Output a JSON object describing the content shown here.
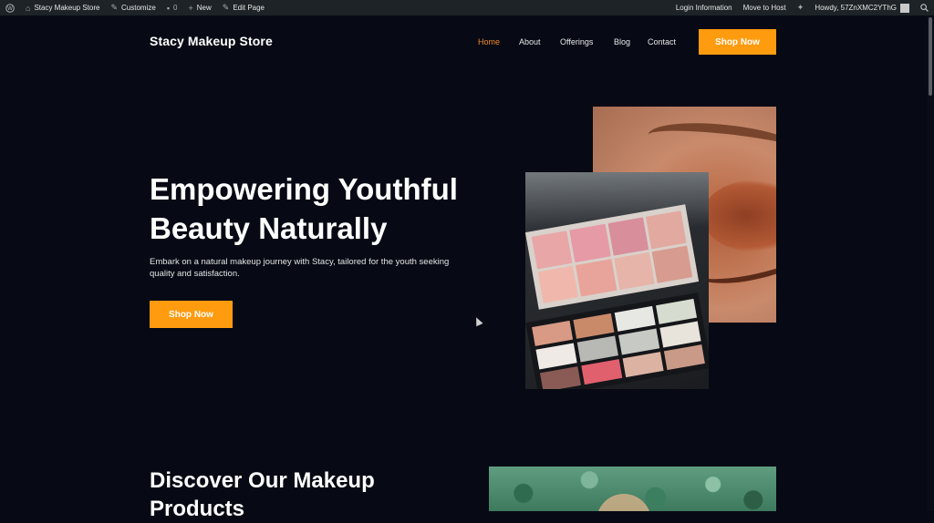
{
  "adminbar": {
    "site_name": "Stacy Makeup Store",
    "customize": "Customize",
    "comments_count": "0",
    "new": "New",
    "edit_page": "Edit Page",
    "login_info": "Login Information",
    "move_to_host": "Move to Host",
    "howdy": "Howdy, 57ZnXMC2YThG"
  },
  "header": {
    "site_title": "Stacy Makeup Store",
    "nav": [
      "Home",
      "About",
      "Offerings",
      "Blog",
      "Contact"
    ],
    "cta": "Shop Now"
  },
  "hero": {
    "title": "Empowering Youthful Beauty Naturally",
    "subtitle": "Embark on a natural makeup journey with Stacy, tailored for the youth seeking quality and satisfaction.",
    "cta": "Shop Now"
  },
  "products": {
    "title": "Discover Our Makeup Products"
  },
  "colors": {
    "accent": "#ff9b0f",
    "nav_active": "#f08a2a",
    "background": "#070a14",
    "adminbar": "#1d2327"
  },
  "icons": [
    "wordpress-icon",
    "brush-icon",
    "comment-icon",
    "plus-icon",
    "pencil-icon",
    "sparkle-icon",
    "search-icon"
  ]
}
